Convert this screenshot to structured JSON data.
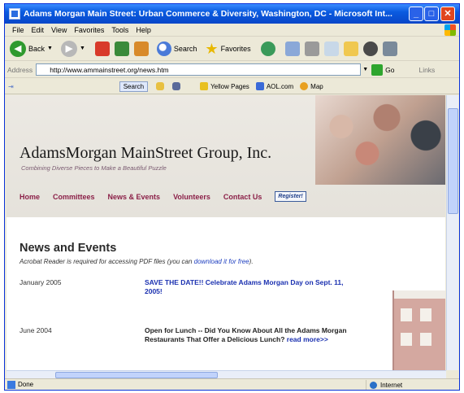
{
  "window": {
    "title": "Adams Morgan Main Street: Urban Commerce & Diversity, Washington, DC - Microsoft Int...",
    "min_glyph": "_",
    "max_glyph": "□",
    "close_glyph": "✕"
  },
  "menu": [
    "File",
    "Edit",
    "View",
    "Favorites",
    "Tools",
    "Help"
  ],
  "toolbar": {
    "back_label": "Back",
    "search_label": "Search",
    "favorites_label": "Favorites"
  },
  "address": {
    "label": "Address",
    "value": "http://www.ammainstreet.org/news.htm",
    "go_label": "Go",
    "links_label": "Links"
  },
  "links_bar": {
    "search_chip": "Search",
    "yellow_pages": "Yellow Pages",
    "aol": "AOL.com",
    "map": "Map"
  },
  "site": {
    "title": "AdamsMorgan  MainStreet Group, Inc.",
    "tagline": "Combining Diverse Pieces to Make a Beautiful Puzzle",
    "nav": [
      "Home",
      "Committees",
      "News & Events",
      "Volunteers",
      "Contact Us"
    ],
    "badge": "Register!"
  },
  "content": {
    "heading": "News and Events",
    "note_prefix": "Acrobat Reader is required for accessing PDF files (you can ",
    "note_link": "download it for free",
    "note_suffix": ").",
    "events": [
      {
        "date": "January 2005",
        "text": "SAVE THE DATE!! Celebrate Adams Morgan Day on Sept. 11, 2005!"
      },
      {
        "date": "June 2004",
        "text": "Open for Lunch -- Did You Know About All the Adams Morgan Restaurants That Offer a Delicious Lunch? ",
        "link": "read more>>"
      }
    ]
  },
  "status": {
    "text": "Done",
    "zone": "Internet"
  }
}
